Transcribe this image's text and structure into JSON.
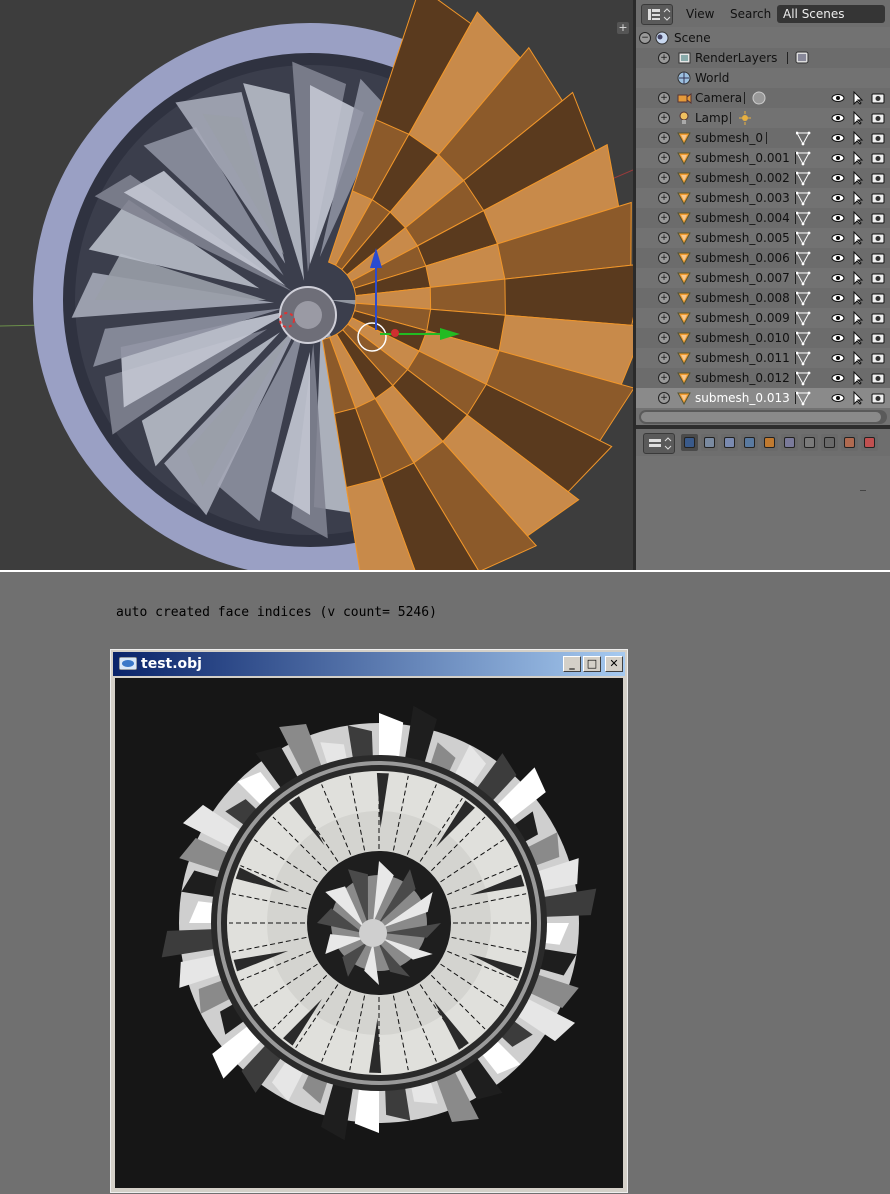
{
  "outliner": {
    "menu_view": "View",
    "menu_search": "Search",
    "scene_selector": "All Scenes",
    "rows": [
      {
        "label": "Scene",
        "kind": "scene"
      },
      {
        "label": "RenderLayers",
        "kind": "renderlayers"
      },
      {
        "label": "World",
        "kind": "world"
      },
      {
        "label": "Camera",
        "kind": "camera"
      },
      {
        "label": "Lamp",
        "kind": "lamp"
      },
      {
        "label": "submesh_0",
        "kind": "mesh"
      },
      {
        "label": "submesh_0.001",
        "kind": "mesh"
      },
      {
        "label": "submesh_0.002",
        "kind": "mesh"
      },
      {
        "label": "submesh_0.003",
        "kind": "mesh"
      },
      {
        "label": "submesh_0.004",
        "kind": "mesh"
      },
      {
        "label": "submesh_0.005",
        "kind": "mesh"
      },
      {
        "label": "submesh_0.006",
        "kind": "mesh"
      },
      {
        "label": "submesh_0.007",
        "kind": "mesh"
      },
      {
        "label": "submesh_0.008",
        "kind": "mesh"
      },
      {
        "label": "submesh_0.009",
        "kind": "mesh"
      },
      {
        "label": "submesh_0.010",
        "kind": "mesh"
      },
      {
        "label": "submesh_0.011",
        "kind": "mesh"
      },
      {
        "label": "submesh_0.012",
        "kind": "mesh"
      },
      {
        "label": "submesh_0.013",
        "kind": "mesh",
        "selected": true
      }
    ]
  },
  "properties": {
    "tabs": [
      "render-icon",
      "render-layers-icon",
      "scene-icon",
      "world-icon",
      "object-icon",
      "constraints-icon",
      "modifiers-icon",
      "data-icon",
      "material-icon",
      "texture-icon"
    ]
  },
  "caption": "auto created face indices (v count= 5246)",
  "window": {
    "title": "test.obj",
    "minimize": "_",
    "maximize": "□",
    "close": "✕"
  },
  "colors": {
    "selection_orange": "#f0962a",
    "viewport_bg": "#3d3d3d",
    "mesh_blue": "#a8aed0",
    "titlebar": "#0a246a"
  }
}
